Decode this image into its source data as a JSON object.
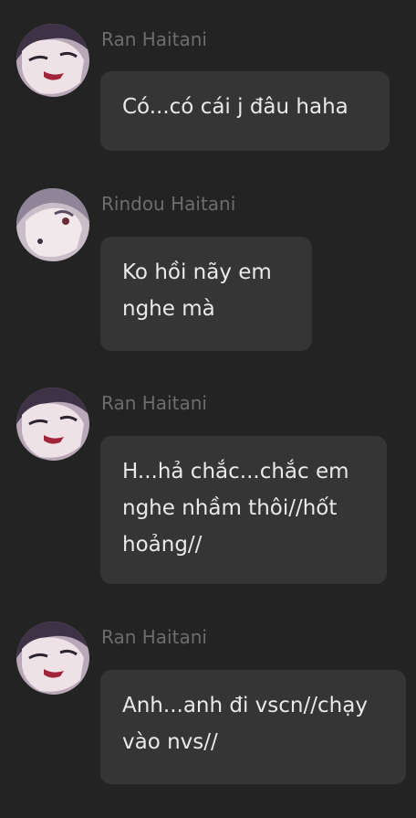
{
  "messages": [
    {
      "sender": "Ran Haitani",
      "text": "Có...có cái j đâu haha"
    },
    {
      "sender": "Rindou Haitani",
      "text": "Ko hồi nãy em nghe mà"
    },
    {
      "sender": "Ran Haitani",
      "text": "H...hả chắc...chắc em nghe nhầm thôi//hốt hoảng//"
    },
    {
      "sender": "Ran Haitani",
      "text": "Anh...anh đi vscn//chạy vào nvs//"
    }
  ]
}
